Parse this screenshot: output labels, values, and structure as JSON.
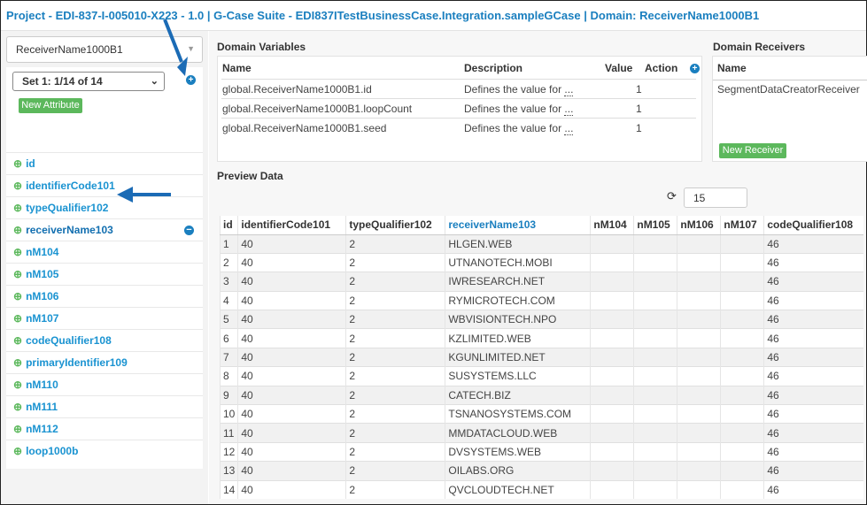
{
  "header": {
    "project": "Project - EDI-837-I-005010-X223 - 1.0",
    "sep": " | ",
    "suite": "G-Case Suite - EDI837ITestBusinessCase.Integration.sampleGCase",
    "domain": "Domain: ReceiverName1000B1"
  },
  "sidebar": {
    "domain_select": "ReceiverName1000B1",
    "set_select": "Set 1: 1/14 of 14",
    "new_attribute": "New Attribute",
    "attributes": [
      "id",
      "identifierCode101",
      "typeQualifier102",
      "receiverName103",
      "nM104",
      "nM105",
      "nM106",
      "nM107",
      "codeQualifier108",
      "primaryIdentifier109",
      "nM110",
      "nM111",
      "nM112",
      "loop1000b"
    ]
  },
  "domain_variables": {
    "title": "Domain Variables",
    "headers": {
      "name": "Name",
      "description": "Description",
      "value": "Value",
      "action": "Action"
    },
    "rows": [
      {
        "name": "global.ReceiverName1000B1.id",
        "description": "Defines the value for",
        "more": "...",
        "value": "1"
      },
      {
        "name": "global.ReceiverName1000B1.loopCount",
        "description": "Defines the value for",
        "more": "...",
        "value": "1"
      },
      {
        "name": "global.ReceiverName1000B1.seed",
        "description": "Defines the value for",
        "more": "...",
        "value": "1"
      }
    ]
  },
  "domain_receivers": {
    "title": "Domain Receivers",
    "header": "Name",
    "rows": [
      "SegmentDataCreatorReceiver"
    ],
    "new_receiver": "New Receiver"
  },
  "preview": {
    "title": "Preview Data",
    "count": "15",
    "columns": [
      "id",
      "identifierCode101",
      "typeQualifier102",
      "receiverName103",
      "nM104",
      "nM105",
      "nM106",
      "nM107",
      "codeQualifier108"
    ],
    "rows": [
      [
        "1",
        "40",
        "2",
        "HLGEN.WEB",
        "",
        "",
        "",
        "",
        "46"
      ],
      [
        "2",
        "40",
        "2",
        "UTNANOTECH.MOBI",
        "",
        "",
        "",
        "",
        "46"
      ],
      [
        "3",
        "40",
        "2",
        "IWRESEARCH.NET",
        "",
        "",
        "",
        "",
        "46"
      ],
      [
        "4",
        "40",
        "2",
        "RYMICROTECH.COM",
        "",
        "",
        "",
        "",
        "46"
      ],
      [
        "5",
        "40",
        "2",
        "WBVISIONTECH.NPO",
        "",
        "",
        "",
        "",
        "46"
      ],
      [
        "6",
        "40",
        "2",
        "KZLIMITED.WEB",
        "",
        "",
        "",
        "",
        "46"
      ],
      [
        "7",
        "40",
        "2",
        "KGUNLIMITED.NET",
        "",
        "",
        "",
        "",
        "46"
      ],
      [
        "8",
        "40",
        "2",
        "SUSYSTEMS.LLC",
        "",
        "",
        "",
        "",
        "46"
      ],
      [
        "9",
        "40",
        "2",
        "CATECH.BIZ",
        "",
        "",
        "",
        "",
        "46"
      ],
      [
        "10",
        "40",
        "2",
        "TSNANOSYSTEMS.COM",
        "",
        "",
        "",
        "",
        "46"
      ],
      [
        "11",
        "40",
        "2",
        "MMDATACLOUD.WEB",
        "",
        "",
        "",
        "",
        "46"
      ],
      [
        "12",
        "40",
        "2",
        "DVSYSTEMS.WEB",
        "",
        "",
        "",
        "",
        "46"
      ],
      [
        "13",
        "40",
        "2",
        "OILABS.ORG",
        "",
        "",
        "",
        "",
        "46"
      ],
      [
        "14",
        "40",
        "2",
        "QVCLOUDTECH.NET",
        "",
        "",
        "",
        "",
        "46"
      ]
    ]
  },
  "colors": {
    "accent": "#1a7fbf",
    "success": "#5cb85c"
  }
}
